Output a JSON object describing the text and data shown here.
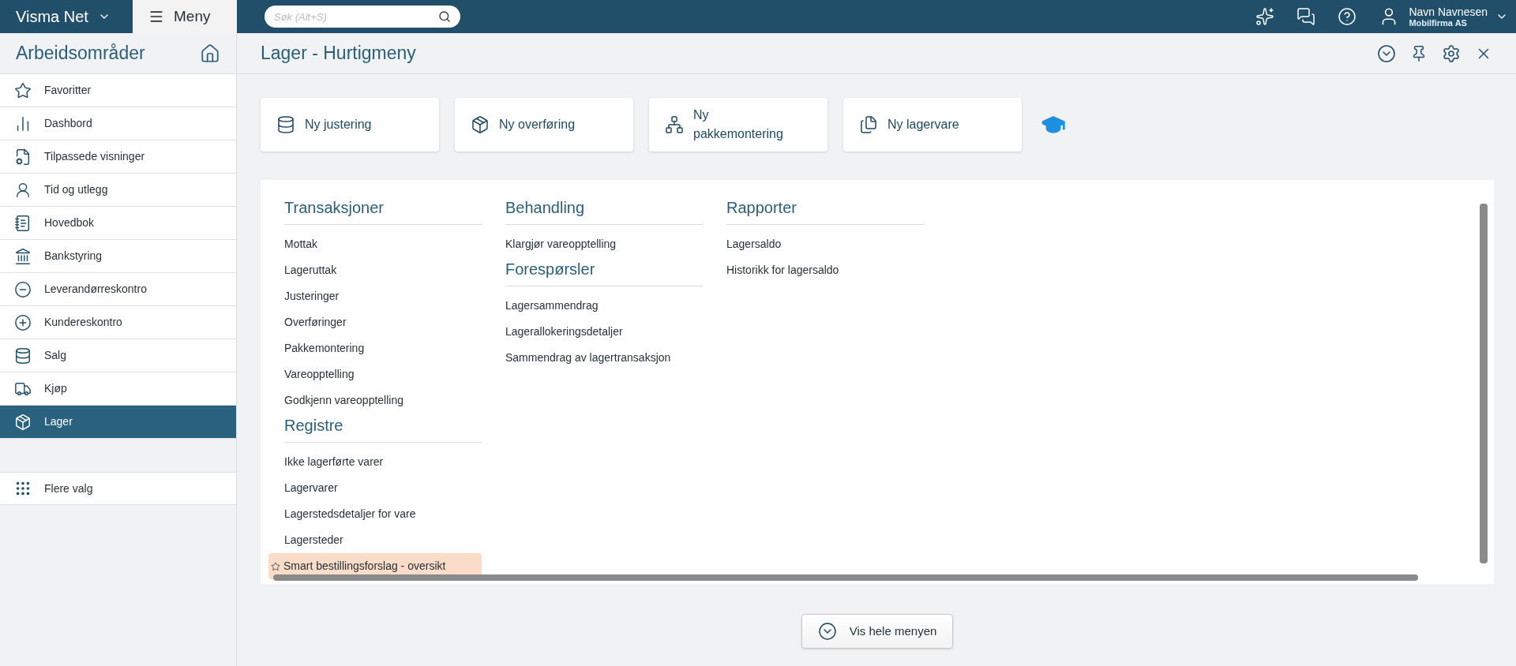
{
  "topbar": {
    "product": "Visma Net",
    "menu_label": "Meny",
    "search": {
      "placeholder": "Søk (Alt+S)"
    },
    "user": {
      "name": "Navn Navnesen",
      "company": "Mobilfirma AS"
    }
  },
  "sidebar": {
    "title": "Arbeidsområder",
    "items": [
      {
        "label": "Favoritter",
        "selected": false
      },
      {
        "label": "Dashbord",
        "selected": false
      },
      {
        "label": "Tilpassede visninger",
        "selected": false
      },
      {
        "label": "Tid og utlegg",
        "selected": false
      },
      {
        "label": "Hovedbok",
        "selected": false
      },
      {
        "label": "Bankstyring",
        "selected": false
      },
      {
        "label": "Leverandørreskontro",
        "selected": false
      },
      {
        "label": "Kundereskontro",
        "selected": false
      },
      {
        "label": "Salg",
        "selected": false
      },
      {
        "label": "Kjøp",
        "selected": false
      },
      {
        "label": "Lager",
        "selected": true
      }
    ],
    "more": "Flere valg"
  },
  "page": {
    "title": "Lager - Hurtigmeny",
    "quick_actions": [
      "Ny justering",
      "Ny overføring",
      "Ny pakkemontering",
      "Ny lagervare"
    ],
    "columns": [
      [
        {
          "heading": "Transaksjoner",
          "items": [
            {
              "label": "Mottak",
              "favorite": false
            },
            {
              "label": "Lageruttak",
              "favorite": false
            },
            {
              "label": "Justeringer",
              "favorite": false
            },
            {
              "label": "Overføringer",
              "favorite": false
            },
            {
              "label": "Pakkemontering",
              "favorite": false
            },
            {
              "label": "Vareopptelling",
              "favorite": false
            },
            {
              "label": "Godkjenn vareopptelling",
              "favorite": false
            }
          ]
        },
        {
          "heading": "Registre",
          "items": [
            {
              "label": "Ikke lagerførte varer",
              "favorite": false
            },
            {
              "label": "Lagervarer",
              "favorite": false
            },
            {
              "label": "Lagerstedsdetaljer for vare",
              "favorite": false
            },
            {
              "label": "Lagersteder",
              "favorite": false
            },
            {
              "label": "Smart bestillingsforslag - oversikt",
              "favorite": true
            }
          ]
        }
      ],
      [
        {
          "heading": "Behandling",
          "items": [
            {
              "label": "Klargjør vareopptelling",
              "favorite": false
            }
          ]
        },
        {
          "heading": "Forespørsler",
          "items": [
            {
              "label": "Lagersammendrag",
              "favorite": false
            },
            {
              "label": "Lagerallokeringsdetaljer",
              "favorite": false
            },
            {
              "label": "Sammendrag av lagertransaksjon",
              "favorite": false
            }
          ]
        }
      ],
      [
        {
          "heading": "Rapporter",
          "items": [
            {
              "label": "Lagersaldo",
              "favorite": false
            },
            {
              "label": "Historikk for lagersaldo",
              "favorite": false
            }
          ]
        }
      ]
    ],
    "show_all": "Vis hele menyen"
  }
}
